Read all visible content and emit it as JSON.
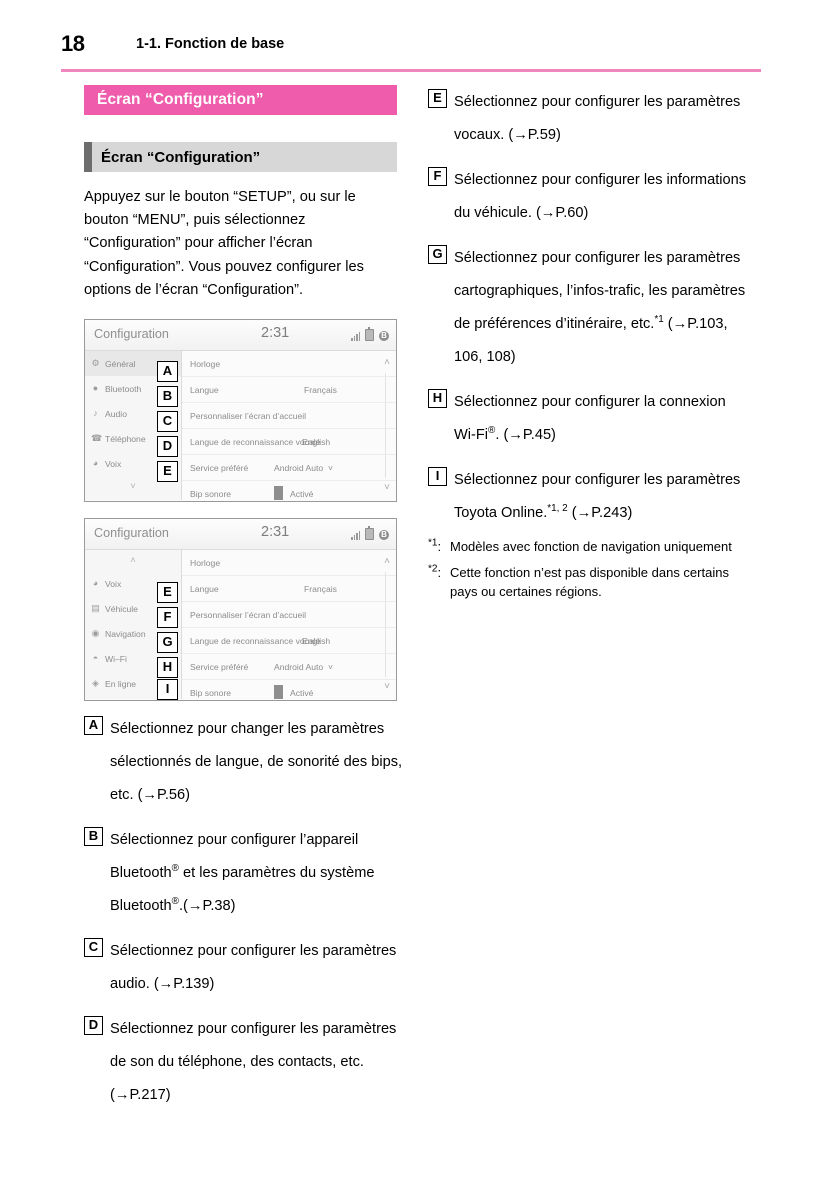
{
  "header": {
    "page_number": "18",
    "chapter": "1-1. Fonction de base"
  },
  "section": {
    "pink_title": "Écran “Configuration”",
    "gray_title": "Écran “Configuration”",
    "paragraph": "Appuyez sur le bouton “SETUP”, ou sur le bouton “MENU”, puis sélectionnez “Configuration” pour afficher l’écran “Configuration”. Vous pouvez configurer les options de l’écran “Configuration”."
  },
  "device_top": {
    "title": "Configuration",
    "clock": "2:31",
    "status_icons": [
      "signal-icon",
      "battery-icon",
      "bluetooth-icon"
    ],
    "sidebar": [
      {
        "label": "Général",
        "icon": "gear-icon",
        "tag": "A"
      },
      {
        "label": "Bluetooth",
        "icon": "bluetooth-icon",
        "tag": "B"
      },
      {
        "label": "Audio",
        "icon": "note-icon",
        "tag": "C"
      },
      {
        "label": "Téléphone",
        "icon": "phone-icon",
        "tag": "D"
      },
      {
        "label": "Voix",
        "icon": "voice-icon",
        "tag": "E"
      }
    ],
    "sidebar_chevron": "chevron-down-icon",
    "rows": [
      {
        "name": "Horloge",
        "value": ""
      },
      {
        "name": "Langue",
        "value": "Français"
      },
      {
        "name": "Personnaliser l’écran d’accueil",
        "value": ""
      },
      {
        "name": "Langue de reconnaissance vocale",
        "value": "English"
      },
      {
        "name": "Service préféré",
        "value": "Android Auto"
      },
      {
        "name": "Bip sonore",
        "value": "Activé"
      }
    ]
  },
  "device_bottom": {
    "title": "Configuration",
    "clock": "2:31",
    "status_icons": [
      "signal-icon",
      "battery-icon",
      "bluetooth-icon"
    ],
    "sidebar_chevron_up": "chevron-up-icon",
    "sidebar": [
      {
        "label": "Voix",
        "icon": "voice-icon",
        "tag": "E"
      },
      {
        "label": "Véhicule",
        "icon": "car-icon",
        "tag": "F"
      },
      {
        "label": "Navigation",
        "icon": "compass-icon",
        "tag": "G"
      },
      {
        "label": "Wi–Fi",
        "icon": "wifi-icon",
        "tag": "H"
      },
      {
        "label": "En ligne",
        "icon": "globe-icon",
        "tag": "I"
      }
    ],
    "rows": [
      {
        "name": "Horloge",
        "value": ""
      },
      {
        "name": "Langue",
        "value": "Français"
      },
      {
        "name": "Personnaliser l’écran d’accueil",
        "value": ""
      },
      {
        "name": "Langue de reconnaissance vocale",
        "value": "English"
      },
      {
        "name": "Service préféré",
        "value": "Android Auto"
      },
      {
        "name": "Bip sonore",
        "value": "Activé"
      }
    ]
  },
  "items_left": [
    {
      "letter": "A",
      "html": "Sélectionnez pour changer les paramètres sélectionnés de langue, de sonorité des bips, etc. (→P.56)"
    },
    {
      "letter": "B",
      "html": "Sélectionnez pour configurer l’appareil Bluetooth<sup>®</sup> et les paramètres du système Bluetooth<sup>®</sup>.(→P.38)"
    },
    {
      "letter": "C",
      "html": "Sélectionnez pour configurer les paramètres audio. (→P.139)"
    },
    {
      "letter": "D",
      "html": "Sélectionnez pour configurer les paramètres de son du téléphone, des contacts, etc. (→P.217)"
    }
  ],
  "items_right": [
    {
      "letter": "E",
      "html": "Sélectionnez pour configurer les paramètres vocaux. (→P.59)"
    },
    {
      "letter": "F",
      "html": "Sélectionnez pour configurer les informations du véhicule. (→P.60)"
    },
    {
      "letter": "G",
      "html": "Sélectionnez pour configurer les paramètres cartographiques, l’infos-trafic, les paramètres de préférences d’itinéraire, etc.<sup>*1</sup> (→P.103, 106, 108)"
    },
    {
      "letter": "H",
      "html": "Sélectionnez pour configurer la connexion Wi-Fi<sup>®</sup>. (→P.45)"
    },
    {
      "letter": "I",
      "html": "Sélectionnez pour configurer les paramètres Toyota Online.<sup>*1, 2</sup> (→P.243)"
    }
  ],
  "footnotes": [
    {
      "mark": "*1:",
      "text": "Modèles avec fonction de navigation uniquement"
    },
    {
      "mark": "*2:",
      "text": "Cette fonction n’est pas disponible dans certains pays ou certaines régions."
    }
  ],
  "colors": {
    "pink": "#ee5cab",
    "rule_pink": "#ef86be",
    "gray_bar": "#d7d7d7",
    "gray_accent": "#6d6d6d"
  }
}
